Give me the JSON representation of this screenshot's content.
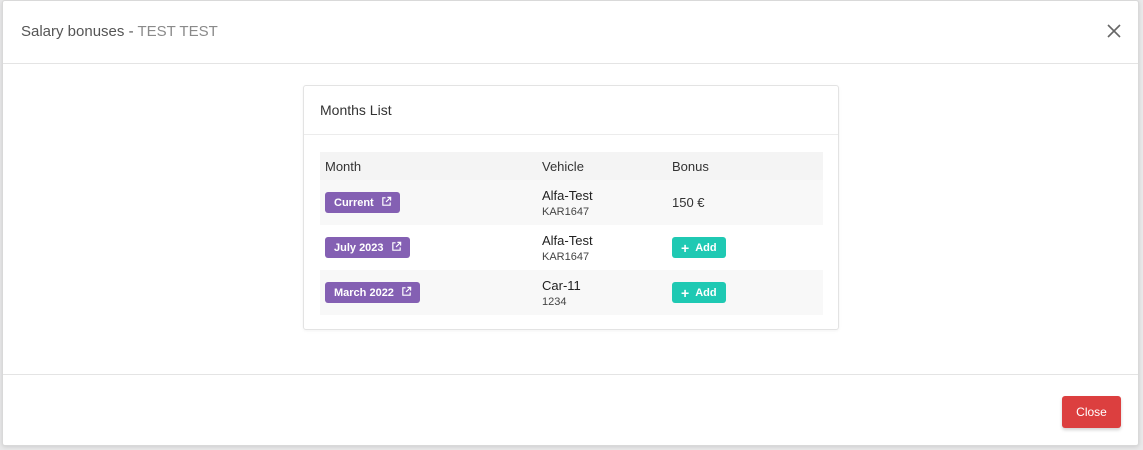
{
  "modal": {
    "title_prefix": "Salary bonuses - ",
    "title_name": "TEST TEST"
  },
  "card": {
    "title": "Months List"
  },
  "table": {
    "headers": {
      "month": "Month",
      "vehicle": "Vehicle",
      "bonus": "Bonus"
    },
    "rows": [
      {
        "month": "Current",
        "vehicle": "Alfa-Test",
        "plate": "KAR1647",
        "bonus": "150 €"
      },
      {
        "month": "July 2023",
        "vehicle": "Alfa-Test",
        "plate": "KAR1647",
        "add_label": "Add"
      },
      {
        "month": "March 2022",
        "vehicle": "Car-11",
        "plate": "1234",
        "add_label": "Add"
      }
    ]
  },
  "footer": {
    "close_label": "Close"
  },
  "icons": {
    "close": "close-icon",
    "external_link": "external-link-icon",
    "plus": "plus-icon"
  },
  "colors": {
    "month_badge": "#8460b3",
    "add_button": "#1fc9b3",
    "close_button": "#dc3f3f"
  }
}
